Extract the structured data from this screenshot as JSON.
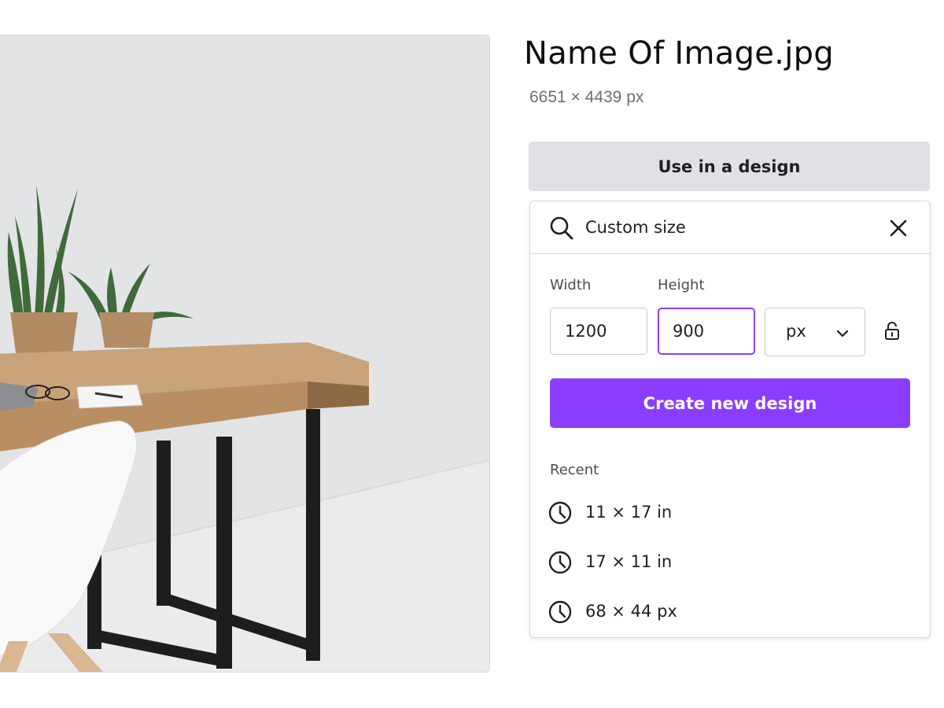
{
  "image": {
    "title": "Name Of Image.jpg",
    "dimensions": "6651 × 4439 px"
  },
  "actions": {
    "use_in_design_label": "Use in a design",
    "create_label": "Create new design"
  },
  "search": {
    "value": "Custom size"
  },
  "custom_size": {
    "width_label": "Width",
    "height_label": "Height",
    "width_value": "1200",
    "height_value": "900",
    "unit": "px"
  },
  "recent": {
    "label": "Recent",
    "items": [
      {
        "label": "11 × 17 in"
      },
      {
        "label": "17 × 11 in"
      },
      {
        "label": "68 × 44 px"
      }
    ]
  },
  "colors": {
    "accent": "#8b3dff",
    "secondary_button": "#dfe1e5",
    "border": "#d6d8dc"
  },
  "icons": {
    "search": "search-icon",
    "close": "close-icon",
    "dropdown": "chevron-down-icon",
    "lock": "unlock-icon",
    "recent": "clock-icon"
  }
}
